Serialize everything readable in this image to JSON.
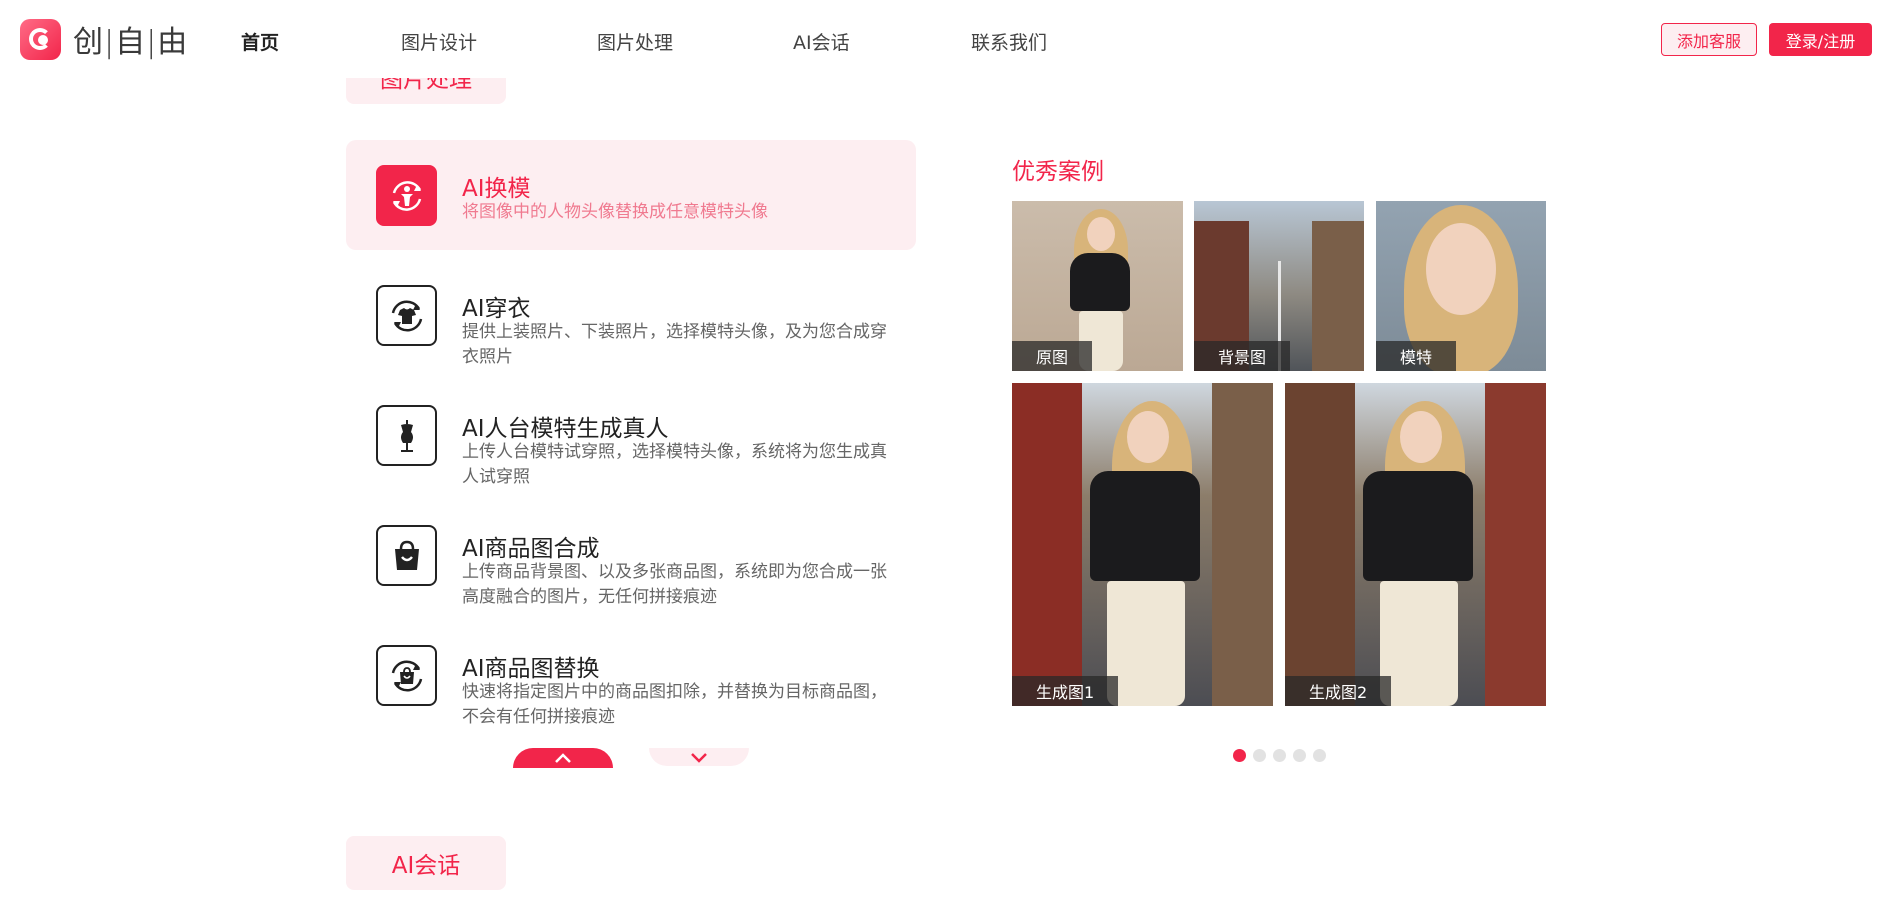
{
  "header": {
    "logo_text": "创|自|由",
    "nav": [
      {
        "label": "首页",
        "active": true
      },
      {
        "label": "图片设计",
        "active": false
      },
      {
        "label": "图片处理",
        "active": false
      },
      {
        "label": "AI会话",
        "active": false
      },
      {
        "label": "联系我们",
        "active": false
      }
    ],
    "service_button": "添加客服",
    "login_button": "登录/注册"
  },
  "section_top": {
    "title": "图片处理"
  },
  "features": [
    {
      "title": "AI换模",
      "desc": "将图像中的人物头像替换成任意模特头像",
      "icon": "face-swap-icon",
      "active": true
    },
    {
      "title": "AI穿衣",
      "desc": "提供上装照片、下装照片，选择模特头像，及为您合成穿衣照片",
      "icon": "tshirt-swap-icon",
      "active": false
    },
    {
      "title": "AI人台模特生成真人",
      "desc": "上传人台模特试穿照，选择模特头像，系统将为您生成真人试穿照",
      "icon": "mannequin-icon",
      "active": false
    },
    {
      "title": "AI商品图合成",
      "desc": "上传商品背景图、以及多张商品图，系统即为您合成一张高度融合的图片，无任何拼接痕迹",
      "icon": "shopping-bag-icon",
      "active": false
    },
    {
      "title": "AI商品图替换",
      "desc": "快速将指定图片中的商品图扣除，并替换为目标商品图，不会有任何拼接痕迹",
      "icon": "bag-swap-icon",
      "active": false
    }
  ],
  "showcase": {
    "title": "优秀案例",
    "photos": {
      "original": "原图",
      "background": "背景图",
      "model": "模特",
      "gen1": "生成图1",
      "gen2": "生成图2"
    },
    "dots": 5,
    "active_dot": 0
  },
  "section_bottom": {
    "title": "AI会话"
  },
  "colors": {
    "accent": "#f2254a",
    "accent_light": "#fdeef1"
  }
}
